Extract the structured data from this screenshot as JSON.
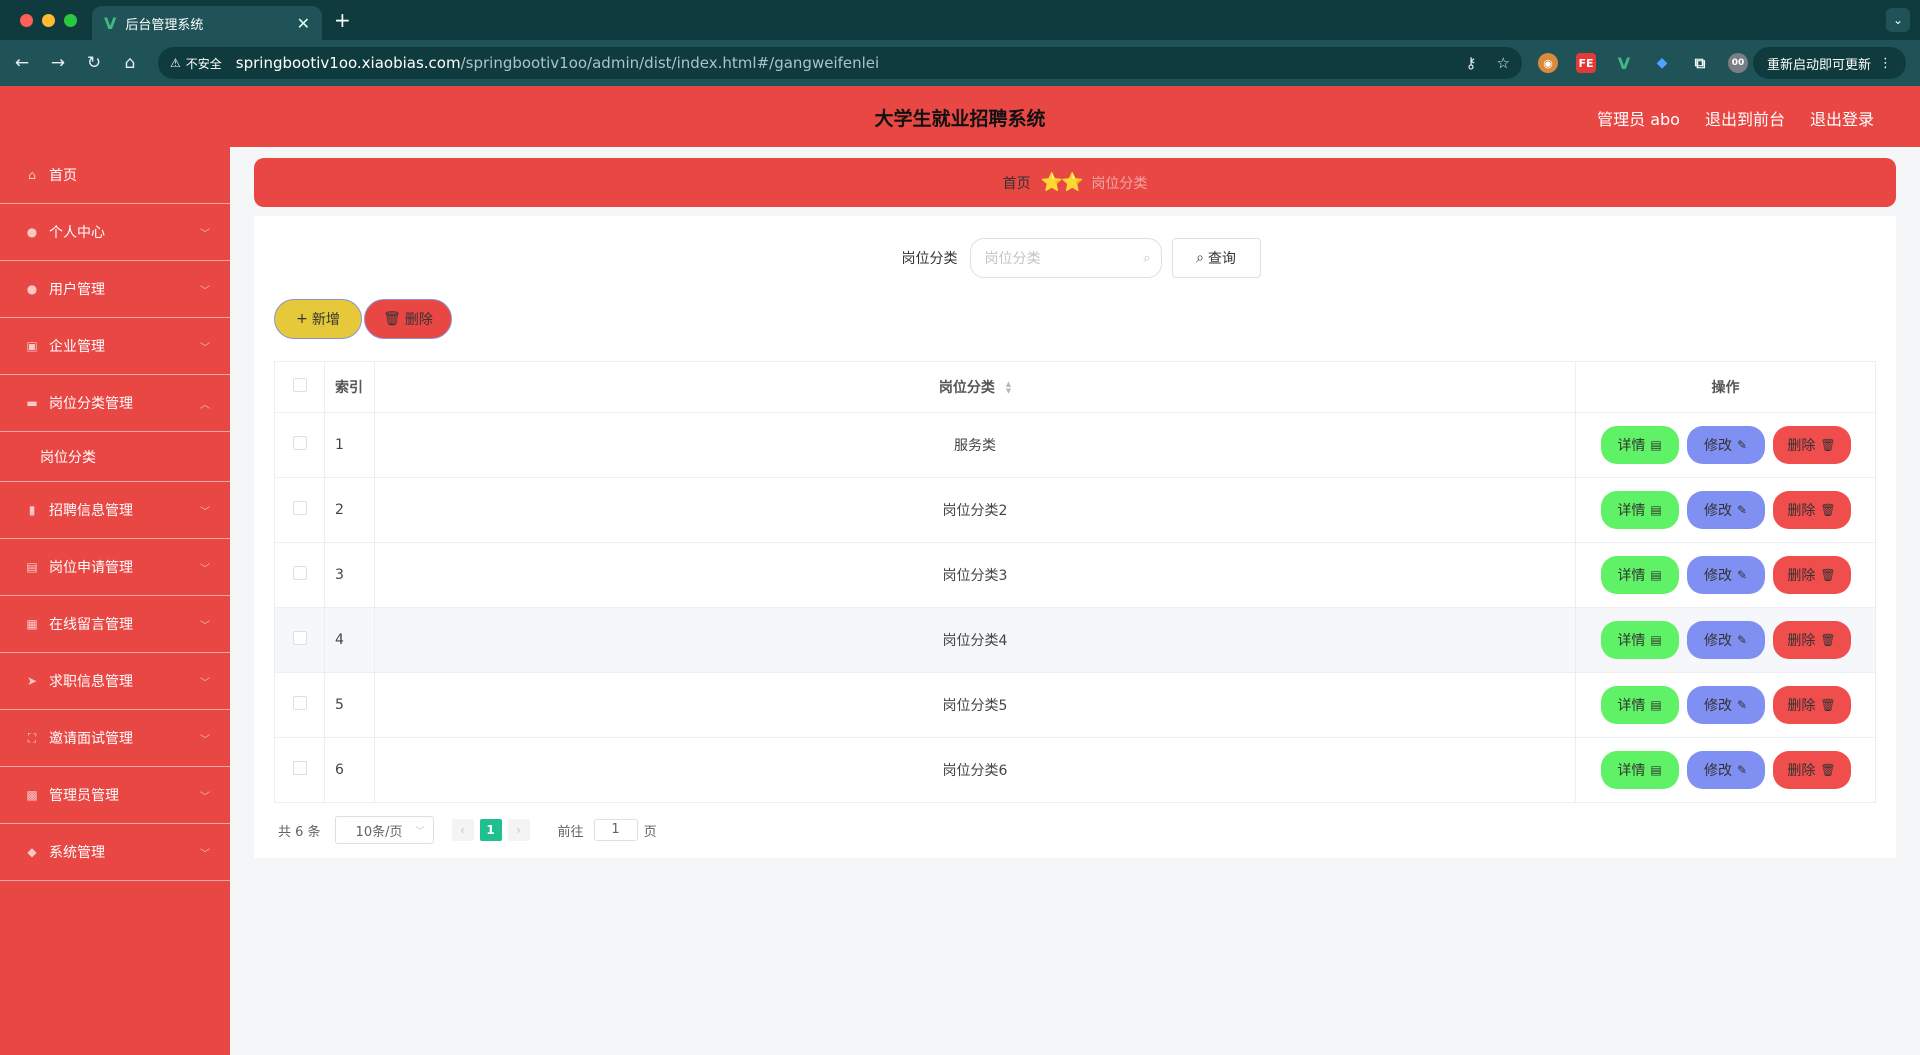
{
  "browser": {
    "tab_title": "后台管理系统",
    "url_host": "springbootiv1oo.xiaobias.com",
    "url_path": "/springbootiv1oo/admin/dist/index.html#/gangweifenlei",
    "insecure_label": "不安全",
    "update_button": "重新启动即可更新",
    "avatar_text": "00"
  },
  "header": {
    "title": "大学生就业招聘系统",
    "links": [
      "管理员 abo",
      "退出到前台",
      "退出登录"
    ]
  },
  "sidebar": {
    "items": [
      {
        "label": "首页",
        "icon": "home-icon"
      },
      {
        "label": "个人中心",
        "icon": "user-icon"
      },
      {
        "label": "用户管理",
        "icon": "user-icon"
      },
      {
        "label": "企业管理",
        "icon": "chart-icon"
      },
      {
        "label": "岗位分类管理",
        "icon": "monitor-icon"
      },
      {
        "label": "岗位分类",
        "icon": ""
      },
      {
        "label": "招聘信息管理",
        "icon": "bar-chart-icon"
      },
      {
        "label": "岗位申请管理",
        "icon": "briefcase-icon"
      },
      {
        "label": "在线留言管理",
        "icon": "grid-icon"
      },
      {
        "label": "求职信息管理",
        "icon": "send-icon"
      },
      {
        "label": "邀请面试管理",
        "icon": "scan-icon"
      },
      {
        "label": "管理员管理",
        "icon": "box-icon"
      },
      {
        "label": "系统管理",
        "icon": "location-icon"
      }
    ]
  },
  "breadcrumb": {
    "home": "首页",
    "separator": "⭐⭐",
    "current": "岗位分类"
  },
  "search": {
    "label": "岗位分类",
    "placeholder": "岗位分类",
    "query_button": "查询"
  },
  "actions": {
    "add_label": "新增",
    "delete_label": "删除"
  },
  "table": {
    "headers": {
      "index": "索引",
      "name": "岗位分类",
      "ops": "操作"
    },
    "op_labels": {
      "detail": "详情",
      "edit": "修改",
      "delete": "删除"
    },
    "rows": [
      {
        "index": "1",
        "name": "服务类"
      },
      {
        "index": "2",
        "name": "岗位分类2"
      },
      {
        "index": "3",
        "name": "岗位分类3"
      },
      {
        "index": "4",
        "name": "岗位分类4"
      },
      {
        "index": "5",
        "name": "岗位分类5"
      },
      {
        "index": "6",
        "name": "岗位分类6"
      }
    ]
  },
  "pagination": {
    "total": "共 6 条",
    "page_size": "10条/页",
    "current_page": "1",
    "goto_label": "前往",
    "goto_value": "1",
    "page_unit": "页"
  },
  "colors": {
    "primary_red": "#e84744",
    "detail_green": "#5ff266",
    "edit_blue": "#7f8ff2",
    "delete_red": "#f04d4d",
    "add_yellow": "#e6c93a"
  }
}
